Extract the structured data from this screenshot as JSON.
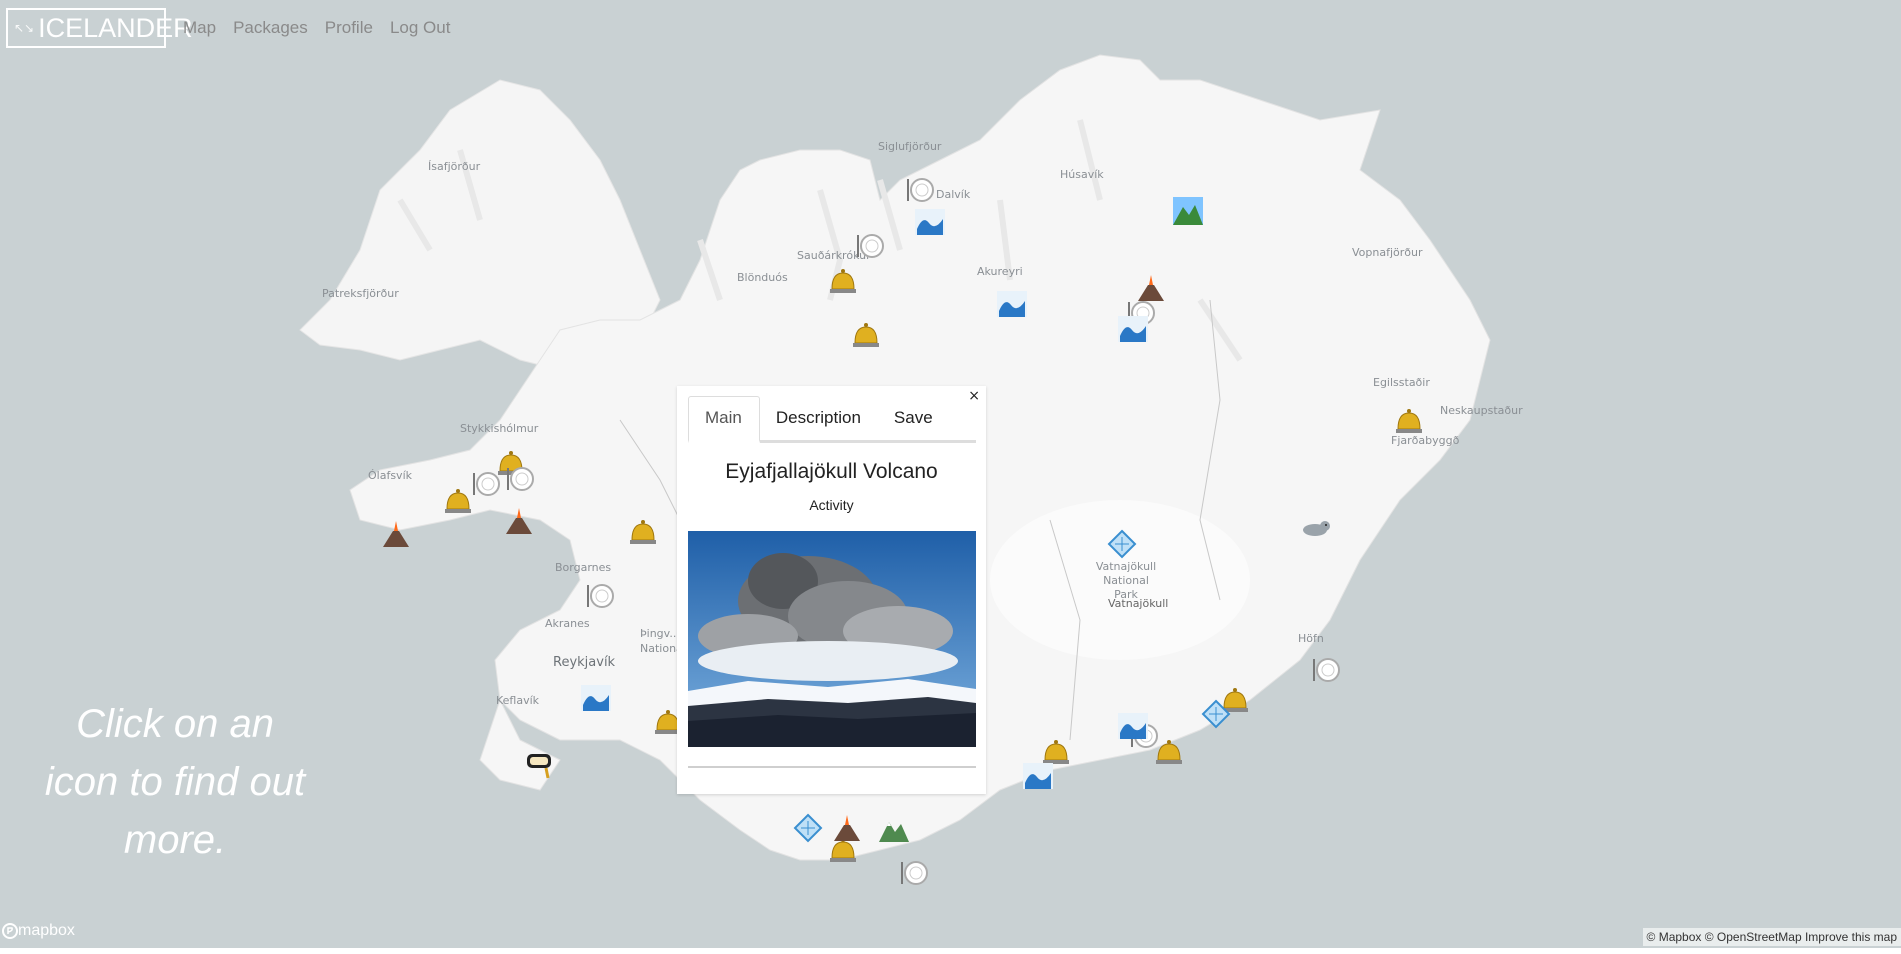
{
  "nav": {
    "logo_text": "ICELANDER",
    "links": [
      "Map",
      "Packages",
      "Profile",
      "Log Out"
    ]
  },
  "hint": "Click on an icon to find out more.",
  "popup": {
    "tabs": [
      "Main",
      "Description",
      "Save"
    ],
    "active_tab": "Main",
    "close": "×",
    "title": "Eyjafjallajökull Volcano",
    "type": "Activity"
  },
  "places": {
    "isafjordur": "Ísafjörður",
    "siglufjordur": "Siglufjörður",
    "dalvik": "Dalvík",
    "husavik": "Húsavík",
    "saudarkrokur": "Sauðárkrókur",
    "blonduos": "Blönduós",
    "akureyri": "Akureyri",
    "vopnafjordur": "Vopnafjörður",
    "patreksfjordur": "Patreksfjörður",
    "egilsstadir": "Egilsstaðir",
    "neskaupstadur": "Neskaupstaður",
    "fjardabyggd": "Fjarðabyggð",
    "stykkisholmur": "Stykkishólmur",
    "olafsvik": "Ólafsvík",
    "borgarnes": "Borgarnes",
    "akranes": "Akranes",
    "thingvellir": "Þingv... Nationa...",
    "reykjavik": "Reykjavík",
    "keflavik": "Keflavík",
    "vatnajokull_np": "Vatnajökull National Park",
    "vatnajokull": "Vatnajökull",
    "hofn": "Höfn"
  },
  "footer": {
    "mapbox": "mapbox",
    "attribution": "© Mapbox © OpenStreetMap Improve this map"
  },
  "colors": {
    "water": "#c9d1d3",
    "land": "#f4f4f4",
    "nav_text": "#8a8a8a"
  }
}
